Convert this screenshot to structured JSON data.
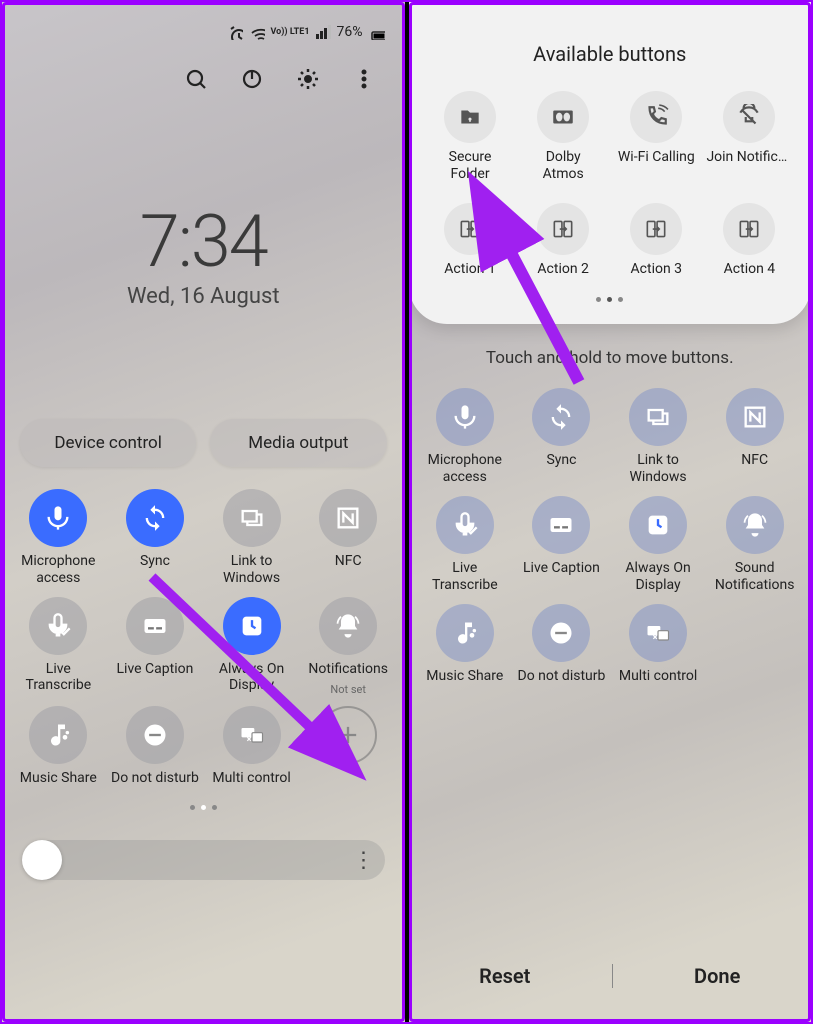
{
  "left": {
    "status": {
      "battery": "76%",
      "network_badge": "Vo)) LTE1"
    },
    "clock": {
      "time": "7:34",
      "date": "Wed, 16 August"
    },
    "pills": {
      "device_control": "Device control",
      "media_output": "Media output"
    },
    "tiles": [
      {
        "id": "mic",
        "label": "Microphone access",
        "active": true,
        "icon": "mic"
      },
      {
        "id": "sync",
        "label": "Sync",
        "active": true,
        "icon": "sync"
      },
      {
        "id": "link",
        "label": "Link to Windows",
        "active": false,
        "icon": "link"
      },
      {
        "id": "nfc",
        "label": "NFC",
        "active": false,
        "icon": "nfc"
      },
      {
        "id": "transcribe",
        "label": "Live Transcribe",
        "active": false,
        "icon": "transcribe"
      },
      {
        "id": "caption",
        "label": "Live Caption",
        "active": false,
        "icon": "caption"
      },
      {
        "id": "aod",
        "label": "Always On Display",
        "active": true,
        "icon": "clock"
      },
      {
        "id": "notif",
        "label": "Notifications",
        "sublabel": "Not set",
        "active": false,
        "icon": "bell"
      },
      {
        "id": "musicshare",
        "label": "Music Share",
        "active": false,
        "icon": "music"
      },
      {
        "id": "dnd",
        "label": "Do not disturb",
        "active": false,
        "icon": "dnd"
      },
      {
        "id": "multi",
        "label": "Multi control",
        "active": false,
        "icon": "multi"
      },
      {
        "id": "add",
        "label": "",
        "active": false,
        "icon": "plus",
        "hollow": true
      }
    ]
  },
  "right": {
    "panel_title": "Available buttons",
    "available": [
      {
        "id": "secure",
        "label": "Secure\nFolder",
        "icon": "folder"
      },
      {
        "id": "dolby",
        "label": "Dolby\nAtmos",
        "icon": "dolby"
      },
      {
        "id": "wificall",
        "label": "Wi-Fi Calling",
        "icon": "wificall"
      },
      {
        "id": "joinnotif",
        "label": "Join Notificat..",
        "icon": "join",
        "truncate": true
      },
      {
        "id": "a1",
        "label": "Action 1",
        "icon": "action"
      },
      {
        "id": "a2",
        "label": "Action 2",
        "icon": "action"
      },
      {
        "id": "a3",
        "label": "Action 3",
        "icon": "action"
      },
      {
        "id": "a4",
        "label": "Action 4",
        "icon": "action"
      }
    ],
    "hint": "Touch and hold to move buttons.",
    "tiles": [
      {
        "id": "mic",
        "label": "Microphone access",
        "icon": "mic"
      },
      {
        "id": "sync",
        "label": "Sync",
        "icon": "sync"
      },
      {
        "id": "link",
        "label": "Link to Windows",
        "icon": "link"
      },
      {
        "id": "nfc",
        "label": "NFC",
        "icon": "nfc"
      },
      {
        "id": "transcribe",
        "label": "Live Transcribe",
        "icon": "transcribe"
      },
      {
        "id": "caption",
        "label": "Live Caption",
        "icon": "caption"
      },
      {
        "id": "aod",
        "label": "Always On Display",
        "icon": "clock"
      },
      {
        "id": "notif",
        "label": "Sound Notifications",
        "icon": "bell"
      },
      {
        "id": "musicshare",
        "label": "Music Share",
        "icon": "music"
      },
      {
        "id": "dnd",
        "label": "Do not disturb",
        "icon": "dnd"
      },
      {
        "id": "multi",
        "label": "Multi control",
        "icon": "multi"
      }
    ],
    "buttons": {
      "reset": "Reset",
      "done": "Done"
    }
  }
}
